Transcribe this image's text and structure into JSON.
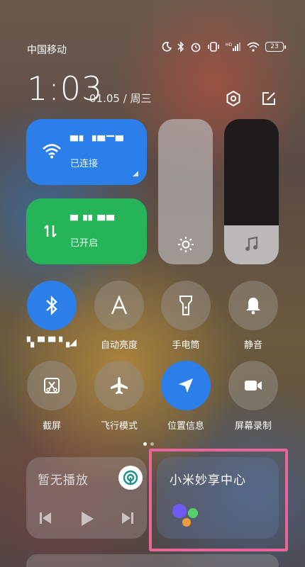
{
  "status_bar": {
    "carrier": "中国移动",
    "battery": "23",
    "icons": [
      "moon-icon",
      "bluetooth-icon",
      "alarm-icon",
      "vibrate-icon",
      "hd-signal-icon",
      "wifi-icon",
      "battery-icon"
    ]
  },
  "header": {
    "time": "1:03",
    "date": "01.05 / 周三",
    "buttons": [
      "settings-icon",
      "edit-icon"
    ]
  },
  "wifi_tile": {
    "network_name": "▀▘▝▀▔▀",
    "status": "已连接",
    "color": "#2c7fe8"
  },
  "data_tile": {
    "network_name": "▀▝▘▀▀",
    "status": "已开启",
    "color": "#25b458"
  },
  "sliders": {
    "brightness_level": 0,
    "volume_level": 0.27
  },
  "toggles_row1": [
    {
      "name": "bluetooth",
      "label": "▚▝▘▀▝▗◢",
      "on": true
    },
    {
      "name": "auto-brightness",
      "label": "自动亮度",
      "on": false
    },
    {
      "name": "flashlight",
      "label": "手电筒",
      "on": false
    },
    {
      "name": "mute",
      "label": "静音",
      "on": false
    }
  ],
  "toggles_row2": [
    {
      "name": "screenshot",
      "label": "截屏",
      "on": false
    },
    {
      "name": "airplane-mode",
      "label": "飞行模式",
      "on": false
    },
    {
      "name": "location",
      "label": "位置信息",
      "on": true
    },
    {
      "name": "screen-record",
      "label": "屏幕录制",
      "on": false
    }
  ],
  "media_card": {
    "title": "暂无播放"
  },
  "share_card": {
    "title": "小米妙享中心"
  },
  "colors": {
    "accent_blue": "#2c7fe8",
    "accent_green": "#25b458",
    "highlight_pink": "#e8669a"
  }
}
